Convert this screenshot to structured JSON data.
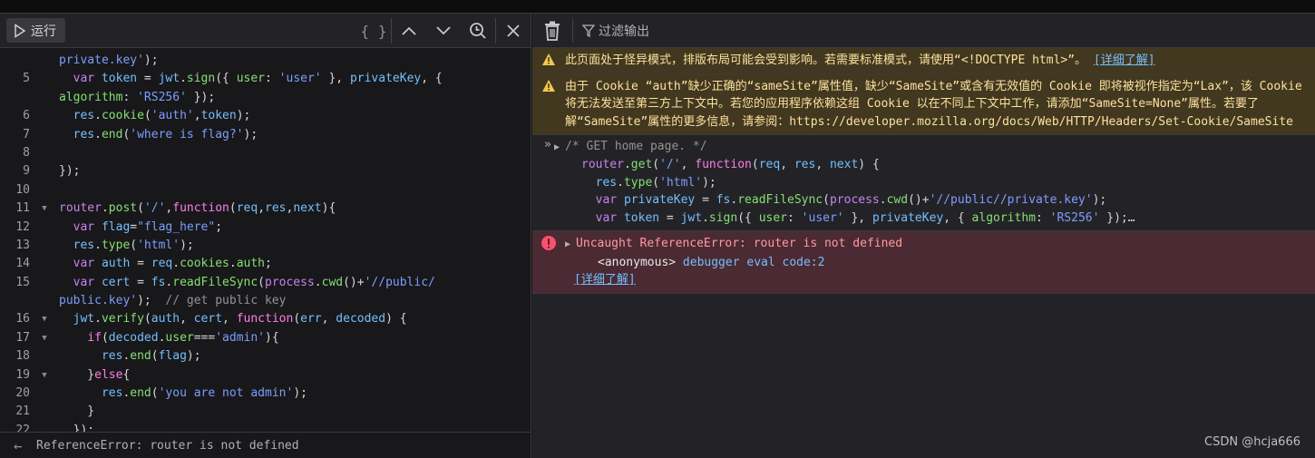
{
  "editor": {
    "run_label": "运行",
    "icons": [
      "braces-icon",
      "chevron-up-icon",
      "chevron-down-icon",
      "search-history-icon",
      "close-icon"
    ],
    "lines": [
      {
        "n": "",
        "fold": false,
        "t": [
          [
            "s",
            "private.key'"
          ],
          [
            "p",
            ");"
          ]
        ]
      },
      {
        "n": "5",
        "fold": false,
        "t": [
          [
            "p",
            "  "
          ],
          [
            "k",
            "var"
          ],
          [
            "p",
            " "
          ],
          [
            "i",
            "token"
          ],
          [
            "p",
            " = "
          ],
          [
            "i",
            "jwt"
          ],
          [
            "p",
            "."
          ],
          [
            "f",
            "sign"
          ],
          [
            "p",
            "({ "
          ],
          [
            "f",
            "user"
          ],
          [
            "p",
            ": "
          ],
          [
            "s",
            "'user'"
          ],
          [
            "p",
            " }, "
          ],
          [
            "i",
            "privateKey"
          ],
          [
            "p",
            ", {"
          ]
        ]
      },
      {
        "n": "",
        "fold": false,
        "t": [
          [
            "f",
            "algorithm"
          ],
          [
            "p",
            ": "
          ],
          [
            "s",
            "'RS256'"
          ],
          [
            "p",
            " });"
          ]
        ]
      },
      {
        "n": "6",
        "fold": false,
        "t": [
          [
            "p",
            "  "
          ],
          [
            "i",
            "res"
          ],
          [
            "p",
            "."
          ],
          [
            "f",
            "cookie"
          ],
          [
            "p",
            "("
          ],
          [
            "s",
            "'auth'"
          ],
          [
            "p",
            ","
          ],
          [
            "i",
            "token"
          ],
          [
            "p",
            ");"
          ]
        ]
      },
      {
        "n": "7",
        "fold": false,
        "t": [
          [
            "p",
            "  "
          ],
          [
            "i",
            "res"
          ],
          [
            "p",
            "."
          ],
          [
            "f",
            "end"
          ],
          [
            "p",
            "("
          ],
          [
            "s",
            "'where is flag?'"
          ],
          [
            "p",
            ");"
          ]
        ]
      },
      {
        "n": "8",
        "fold": false,
        "t": []
      },
      {
        "n": "9",
        "fold": false,
        "t": [
          [
            "p",
            "});"
          ]
        ]
      },
      {
        "n": "10",
        "fold": false,
        "t": []
      },
      {
        "n": "11",
        "fold": true,
        "t": [
          [
            "o",
            "router"
          ],
          [
            "p",
            "."
          ],
          [
            "f",
            "post"
          ],
          [
            "p",
            "("
          ],
          [
            "s",
            "'/'"
          ],
          [
            "p",
            ","
          ],
          [
            "kf",
            "function"
          ],
          [
            "p",
            "("
          ],
          [
            "i",
            "req"
          ],
          [
            "p",
            ","
          ],
          [
            "i",
            "res"
          ],
          [
            "p",
            ","
          ],
          [
            "i",
            "next"
          ],
          [
            "p",
            "){"
          ]
        ]
      },
      {
        "n": "12",
        "fold": false,
        "t": [
          [
            "p",
            "  "
          ],
          [
            "k",
            "var"
          ],
          [
            "p",
            " "
          ],
          [
            "i",
            "flag"
          ],
          [
            "p",
            "="
          ],
          [
            "s",
            "\"flag_here\""
          ],
          [
            "p",
            ";"
          ]
        ]
      },
      {
        "n": "13",
        "fold": false,
        "t": [
          [
            "p",
            "  "
          ],
          [
            "i",
            "res"
          ],
          [
            "p",
            "."
          ],
          [
            "f",
            "type"
          ],
          [
            "p",
            "("
          ],
          [
            "s",
            "'html'"
          ],
          [
            "p",
            ");"
          ]
        ]
      },
      {
        "n": "14",
        "fold": false,
        "t": [
          [
            "p",
            "  "
          ],
          [
            "k",
            "var"
          ],
          [
            "p",
            " "
          ],
          [
            "i",
            "auth"
          ],
          [
            "p",
            " = "
          ],
          [
            "i",
            "req"
          ],
          [
            "p",
            "."
          ],
          [
            "f",
            "cookies"
          ],
          [
            "p",
            "."
          ],
          [
            "f",
            "auth"
          ],
          [
            "p",
            ";"
          ]
        ]
      },
      {
        "n": "15",
        "fold": false,
        "t": [
          [
            "p",
            "  "
          ],
          [
            "k",
            "var"
          ],
          [
            "p",
            " "
          ],
          [
            "i",
            "cert"
          ],
          [
            "p",
            " = "
          ],
          [
            "i",
            "fs"
          ],
          [
            "p",
            "."
          ],
          [
            "f",
            "readFileSync"
          ],
          [
            "p",
            "("
          ],
          [
            "o",
            "process"
          ],
          [
            "p",
            "."
          ],
          [
            "f",
            "cwd"
          ],
          [
            "p",
            "()+"
          ],
          [
            "s",
            "'//public/"
          ]
        ]
      },
      {
        "n": "",
        "fold": false,
        "t": [
          [
            "s",
            "public.key'"
          ],
          [
            "p",
            ");  "
          ],
          [
            "c",
            "// get public key"
          ]
        ]
      },
      {
        "n": "16",
        "fold": true,
        "t": [
          [
            "p",
            "  "
          ],
          [
            "i",
            "jwt"
          ],
          [
            "p",
            "."
          ],
          [
            "f",
            "verify"
          ],
          [
            "p",
            "("
          ],
          [
            "i",
            "auth"
          ],
          [
            "p",
            ", "
          ],
          [
            "i",
            "cert"
          ],
          [
            "p",
            ", "
          ],
          [
            "kf",
            "function"
          ],
          [
            "p",
            "("
          ],
          [
            "i",
            "err"
          ],
          [
            "p",
            ", "
          ],
          [
            "i",
            "decoded"
          ],
          [
            "p",
            ") {"
          ]
        ]
      },
      {
        "n": "17",
        "fold": true,
        "t": [
          [
            "p",
            "    "
          ],
          [
            "kf",
            "if"
          ],
          [
            "p",
            "("
          ],
          [
            "i",
            "decoded"
          ],
          [
            "p",
            "."
          ],
          [
            "f",
            "user"
          ],
          [
            "p",
            "==="
          ],
          [
            "s",
            "'admin'"
          ],
          [
            "p",
            "){"
          ]
        ]
      },
      {
        "n": "18",
        "fold": false,
        "t": [
          [
            "p",
            "      "
          ],
          [
            "i",
            "res"
          ],
          [
            "p",
            "."
          ],
          [
            "f",
            "end"
          ],
          [
            "p",
            "("
          ],
          [
            "i",
            "flag"
          ],
          [
            "p",
            ");"
          ]
        ]
      },
      {
        "n": "19",
        "fold": true,
        "t": [
          [
            "p",
            "    }"
          ],
          [
            "kf",
            "else"
          ],
          [
            "p",
            "{"
          ]
        ]
      },
      {
        "n": "20",
        "fold": false,
        "t": [
          [
            "p",
            "      "
          ],
          [
            "i",
            "res"
          ],
          [
            "p",
            "."
          ],
          [
            "f",
            "end"
          ],
          [
            "p",
            "("
          ],
          [
            "s",
            "'you are not admin'"
          ],
          [
            "p",
            ");"
          ]
        ]
      },
      {
        "n": "21",
        "fold": false,
        "t": [
          [
            "p",
            "    }"
          ]
        ]
      },
      {
        "n": "22",
        "fold": false,
        "t": [
          [
            "p",
            "  });"
          ]
        ]
      }
    ],
    "status": "ReferenceError: router is not defined"
  },
  "console": {
    "filter_label": "过滤输出",
    "warning1": {
      "text": "此页面处于怪异模式，排版布局可能会受到影响。若需要标准模式，请使用“<!DOCTYPE html>”。 ",
      "link": "[详细了解]"
    },
    "warning2": {
      "text": "由于 Cookie “auth”缺少正确的“sameSite”属性值，缺少“SameSite”或含有无效值的 Cookie 即将被视作指定为“Lax”，该 Cookie 将无法发送至第三方上下文中。若您的应用程序依赖这组 Cookie 以在不同上下文中工作，请添加“SameSite=None”属性。若要了解“SameSite”属性的更多信息，请参阅：https://developer.mozilla.org/docs/Web/HTTP/Headers/Set-Cookie/SameSite"
    },
    "input_lines": [
      [
        [
          "c",
          "/* GET home page. */"
        ]
      ],
      [
        [
          "o",
          "router"
        ],
        [
          "p",
          "."
        ],
        [
          "f",
          "get"
        ],
        [
          "p",
          "("
        ],
        [
          "s",
          "'/'"
        ],
        [
          "p",
          ", "
        ],
        [
          "kf",
          "function"
        ],
        [
          "p",
          "("
        ],
        [
          "i",
          "req"
        ],
        [
          "p",
          ", "
        ],
        [
          "i",
          "res"
        ],
        [
          "p",
          ", "
        ],
        [
          "i",
          "next"
        ],
        [
          "p",
          ") {"
        ]
      ],
      [
        [
          "p",
          "  "
        ],
        [
          "i",
          "res"
        ],
        [
          "p",
          "."
        ],
        [
          "f",
          "type"
        ],
        [
          "p",
          "("
        ],
        [
          "s",
          "'html'"
        ],
        [
          "p",
          ");"
        ]
      ],
      [
        [
          "p",
          "  "
        ],
        [
          "k",
          "var"
        ],
        [
          "p",
          " "
        ],
        [
          "i",
          "privateKey"
        ],
        [
          "p",
          " = "
        ],
        [
          "i",
          "fs"
        ],
        [
          "p",
          "."
        ],
        [
          "f",
          "readFileSync"
        ],
        [
          "p",
          "("
        ],
        [
          "o",
          "process"
        ],
        [
          "p",
          "."
        ],
        [
          "f",
          "cwd"
        ],
        [
          "p",
          "()+"
        ],
        [
          "s",
          "'//public//private.key'"
        ],
        [
          "p",
          ");"
        ]
      ],
      [
        [
          "p",
          "  "
        ],
        [
          "k",
          "var"
        ],
        [
          "p",
          " "
        ],
        [
          "i",
          "token"
        ],
        [
          "p",
          " = "
        ],
        [
          "i",
          "jwt"
        ],
        [
          "p",
          "."
        ],
        [
          "f",
          "sign"
        ],
        [
          "p",
          "({ "
        ],
        [
          "f",
          "user"
        ],
        [
          "p",
          ": "
        ],
        [
          "s",
          "'user'"
        ],
        [
          "p",
          " }, "
        ],
        [
          "i",
          "privateKey"
        ],
        [
          "p",
          ", { "
        ],
        [
          "f",
          "algorithm"
        ],
        [
          "p",
          ": "
        ],
        [
          "s",
          "'RS256'"
        ],
        [
          "p",
          " });…"
        ]
      ]
    ],
    "error": {
      "text": "Uncaught ReferenceError: router is not defined",
      "frame_name": "<anonymous>",
      "frame_loc": "debugger eval code:2",
      "link": "[详细了解]"
    }
  },
  "watermark": "CSDN @hcja666",
  "colors": {
    "warning_bg": "#42381f",
    "error_bg": "#4b2a33",
    "accent": "#75bfff"
  }
}
